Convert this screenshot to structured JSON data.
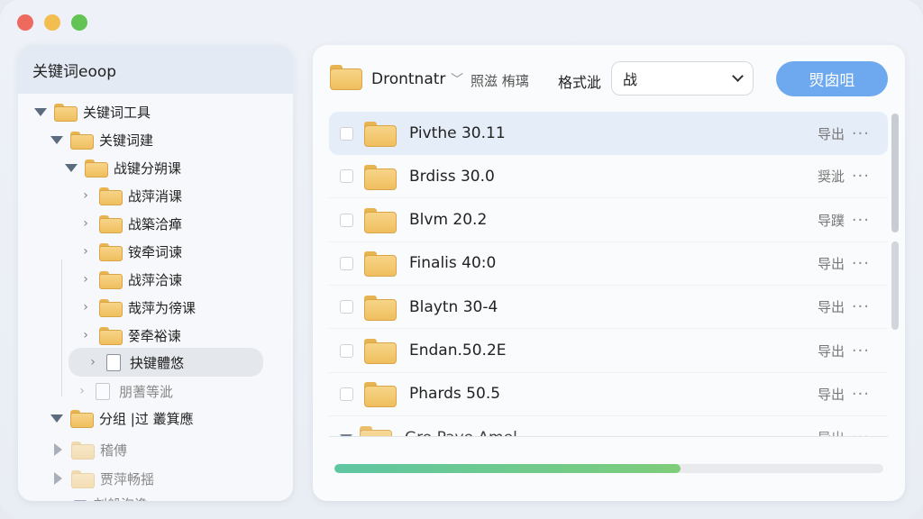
{
  "window": {
    "controls": [
      "close",
      "minimize",
      "zoom"
    ]
  },
  "sidebar": {
    "title": "关键词eoop",
    "tree": [
      {
        "label": "关键词工具",
        "icon": "folder-icon",
        "expander": "expanded"
      },
      {
        "label": "关键词建",
        "icon": "folder-icon",
        "expander": "expanded"
      },
      {
        "label": "战键分朔课",
        "icon": "folder-icon",
        "expander": "expanded"
      },
      {
        "label": "战萍消课",
        "icon": "folder-icon",
        "expander": "collapsed"
      },
      {
        "label": "战築洽瘅",
        "icon": "folder-icon",
        "expander": "collapsed"
      },
      {
        "label": "铵牵词谏",
        "icon": "folder-icon",
        "expander": "collapsed"
      },
      {
        "label": "战萍洽谏",
        "icon": "folder-icon",
        "expander": "collapsed"
      },
      {
        "label": "哉萍为徬课",
        "icon": "folder-icon",
        "expander": "collapsed"
      },
      {
        "label": "쯏牵裕谏",
        "icon": "folder-icon",
        "expander": "collapsed"
      },
      {
        "label": "抉键體悠",
        "icon": "file-icon",
        "expander": "collapsed",
        "selected": true
      },
      {
        "label": "朋蓍等泚",
        "icon": "file-icon",
        "expander": "collapsed",
        "faded": true
      },
      {
        "label": "分组 |过 叢箕應",
        "icon": "folder-icon",
        "expander": "expanded"
      },
      {
        "label": "稽傅",
        "icon": "folder-icon",
        "expander": "collapsed-filled",
        "faded": true
      },
      {
        "label": "贾萍畅揺",
        "icon": "folder-icon",
        "expander": "collapsed-filled",
        "faded": true
      },
      {
        "label": "刘船泡谗",
        "icon": "none",
        "expander": "expanded",
        "faded": true
      }
    ]
  },
  "toolbar": {
    "folder_name": "Drontnatr",
    "path_sub": "照滋 栯璃",
    "format_label": "格式泚",
    "format_value": "战",
    "primary_button": "焽囱咀"
  },
  "files": [
    {
      "name": "Pivthe 30.11",
      "action": "导出",
      "more": "···",
      "highlight": true
    },
    {
      "name": "Brdiss 30.0",
      "action": "奨泚",
      "more": "···"
    },
    {
      "name": "Blvm 20.2",
      "action": "导蹼",
      "more": "···"
    },
    {
      "name": "Finalis 40:0",
      "action": "导出",
      "more": "···"
    },
    {
      "name": "Blaytn 30-4",
      "action": "导出",
      "more": "···"
    },
    {
      "name": "Endan.50.2E",
      "action": "导出",
      "more": "···"
    },
    {
      "name": "Phards 50.5",
      "action": "导出",
      "more": "···"
    },
    {
      "name": "Gro Pave Amel",
      "action": "导出",
      "more": "···",
      "partial": true
    }
  ],
  "progress": {
    "value": 0.63
  },
  "colors": {
    "accent": "#6ea8ee",
    "progress_start": "#5ec6a2",
    "progress_end": "#7ecd7a",
    "folder": "#f2c66b"
  }
}
